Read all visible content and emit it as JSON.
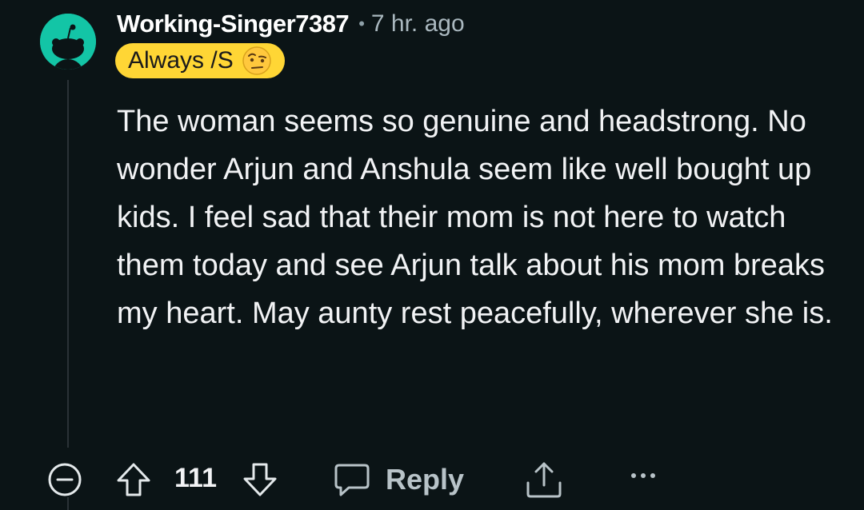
{
  "comment": {
    "username": "Working-Singer7387",
    "separator": "•",
    "time": "7 hr. ago",
    "flair": {
      "text": "Always /S",
      "emoji": "face-with-raised-eyebrow-icon",
      "color": "#ffd635"
    },
    "avatar": {
      "icon": "snoo-avatar-icon",
      "color": "#13c5a6"
    },
    "body": "The woman seems so genuine and headstrong. No wonder Arjun and Anshula seem like well bought up kids. I feel sad that their mom is not here to watch them today and see Arjun talk about his mom breaks my heart. May aunty rest peacefully, wherever she is."
  },
  "actions": {
    "collapse_icon": "minus-circle-icon",
    "upvote_icon": "upvote-arrow-icon",
    "score": "111",
    "downvote_icon": "downvote-arrow-icon",
    "reply_icon": "chat-bubble-icon",
    "reply_label": "Reply",
    "share_icon": "share-icon",
    "more_icon": "more-options-icon"
  },
  "theme": {
    "background": "#0b1416",
    "text": "#f2f3f5",
    "muted": "#aab8bf"
  }
}
